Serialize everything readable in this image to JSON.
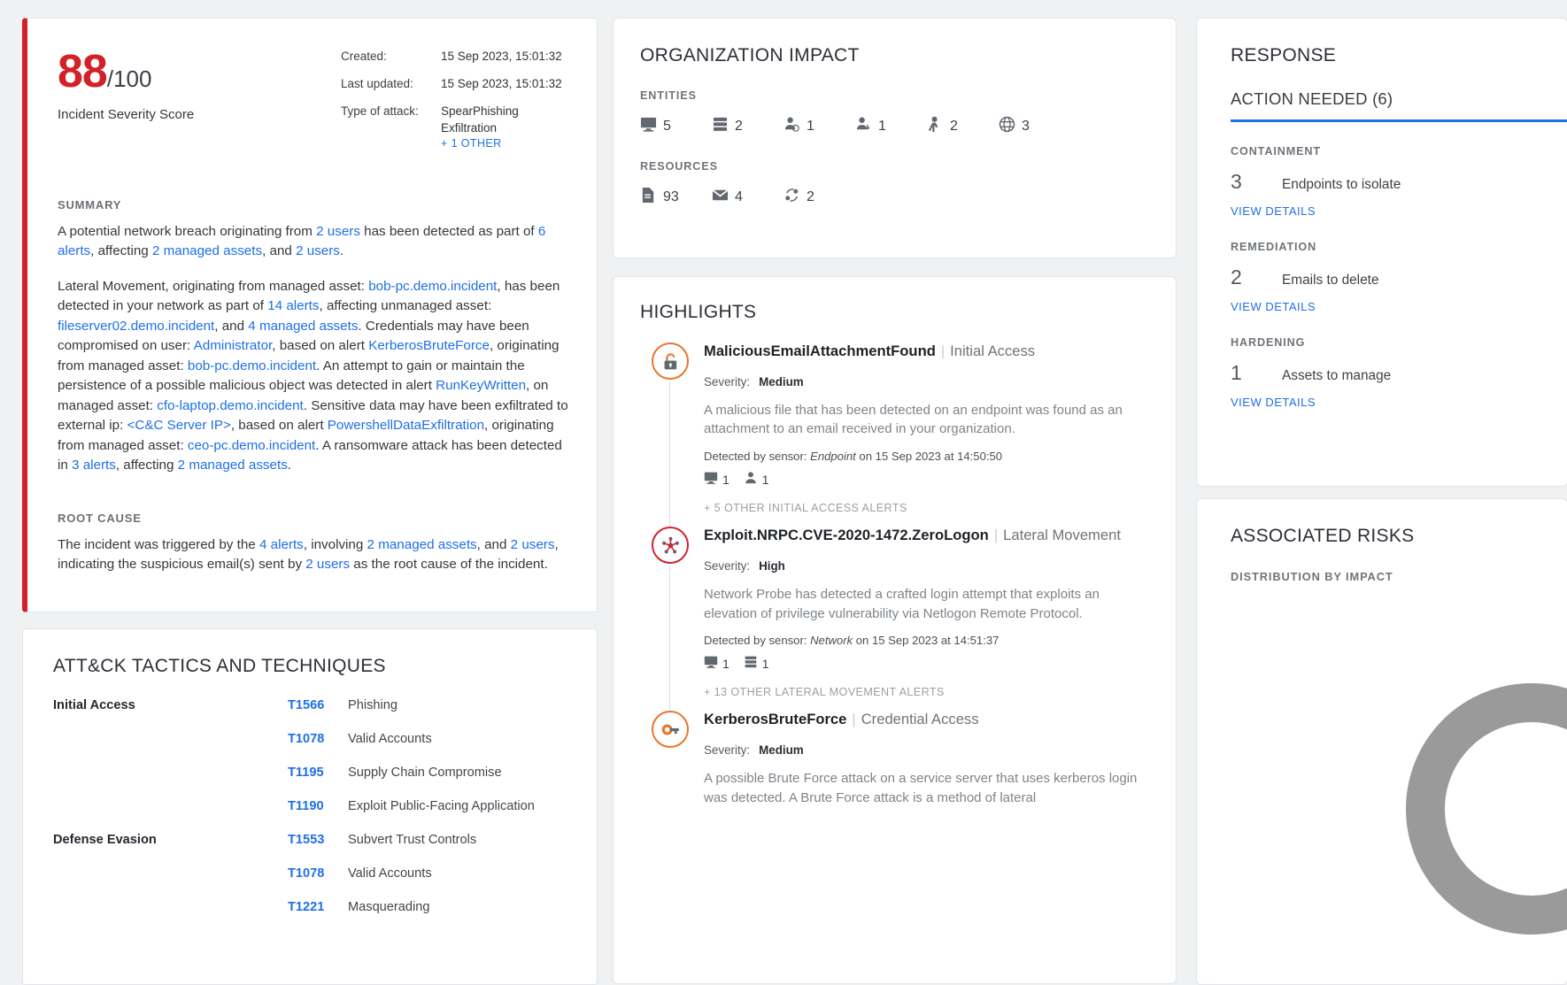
{
  "overview": {
    "score": "88",
    "score_denominator": "/100",
    "score_label": "Incident Severity Score",
    "meta": [
      {
        "key": "Created:",
        "value": "15 Sep 2023, 15:01:32"
      },
      {
        "key": "Last updated:",
        "value": "15 Sep 2023, 15:01:32"
      },
      {
        "key": "Type of attack:",
        "value": "SpearPhishing\nExfiltration"
      }
    ],
    "more_link": "+ 1 OTHER",
    "summary_head": "SUMMARY",
    "summary_p1": [
      {
        "t": "A potential network breach originating from ",
        "link": false
      },
      {
        "t": "2 users",
        "link": true
      },
      {
        "t": " has been detected as part of ",
        "link": false
      },
      {
        "t": "6 alerts",
        "link": true
      },
      {
        "t": ", affecting ",
        "link": false
      },
      {
        "t": "2 managed assets",
        "link": true
      },
      {
        "t": ", and ",
        "link": false
      },
      {
        "t": "2 users",
        "link": true
      },
      {
        "t": ".",
        "link": false
      }
    ],
    "summary_p2": [
      {
        "t": "Lateral Movement, originating from managed asset: ",
        "link": false
      },
      {
        "t": "bob-pc.demo.incident",
        "link": true
      },
      {
        "t": ", has been detected in your network as part of ",
        "link": false
      },
      {
        "t": "14 alerts",
        "link": true
      },
      {
        "t": ", affecting unmanaged asset: ",
        "link": false
      },
      {
        "t": "fileserver02.demo.incident",
        "link": true
      },
      {
        "t": ", and ",
        "link": false
      },
      {
        "t": "4 managed assets",
        "link": true
      },
      {
        "t": ". Credentials may have been compromised on user: ",
        "link": false
      },
      {
        "t": "Administrator",
        "link": true
      },
      {
        "t": ", based on alert ",
        "link": false
      },
      {
        "t": "KerberosBruteForce",
        "link": true
      },
      {
        "t": ", originating from managed asset: ",
        "link": false
      },
      {
        "t": "bob-pc.demo.incident",
        "link": true
      },
      {
        "t": ". An attempt to gain or maintain the persistence of a possible malicious object was detected in alert ",
        "link": false
      },
      {
        "t": "RunKeyWritten",
        "link": true
      },
      {
        "t": ", on managed asset: ",
        "link": false
      },
      {
        "t": "cfo-laptop.demo.incident",
        "link": true
      },
      {
        "t": ". Sensitive data may have been exfiltrated to external ip: ",
        "link": false
      },
      {
        "t": "<C&C Server IP>",
        "link": true
      },
      {
        "t": ", based on alert ",
        "link": false
      },
      {
        "t": "PowershellDataExfiltration",
        "link": true
      },
      {
        "t": ", originating from managed asset: ",
        "link": false
      },
      {
        "t": "ceo-pc.demo.incident",
        "link": true
      },
      {
        "t": ". A ransomware attack has been detected in ",
        "link": false
      },
      {
        "t": "3 alerts",
        "link": true
      },
      {
        "t": ", affecting ",
        "link": false
      },
      {
        "t": "2 managed assets",
        "link": true
      },
      {
        "t": ".",
        "link": false
      }
    ],
    "root_cause_head": "ROOT CAUSE",
    "root_cause_p": [
      {
        "t": "The incident was triggered by the ",
        "link": false
      },
      {
        "t": "4 alerts",
        "link": true
      },
      {
        "t": ", involving ",
        "link": false
      },
      {
        "t": "2 managed assets",
        "link": true
      },
      {
        "t": ", and ",
        "link": false
      },
      {
        "t": "2 users",
        "link": true
      },
      {
        "t": ", indicating the suspicious email(s) sent by ",
        "link": false
      },
      {
        "t": "2 users",
        "link": true
      },
      {
        "t": " as the root cause of the incident.",
        "link": false
      }
    ]
  },
  "attack": {
    "title": "ATT&CK TACTICS AND TECHNIQUES",
    "rows": [
      {
        "tactic": "Initial Access",
        "id": "T1566",
        "name": "Phishing"
      },
      {
        "tactic": "",
        "id": "T1078",
        "name": "Valid Accounts"
      },
      {
        "tactic": "",
        "id": "T1195",
        "name": "Supply Chain Compromise"
      },
      {
        "tactic": "",
        "id": "T1190",
        "name": "Exploit Public-Facing Application"
      },
      {
        "tactic": "Defense Evasion",
        "id": "T1553",
        "name": "Subvert Trust Controls"
      },
      {
        "tactic": "",
        "id": "T1078",
        "name": "Valid Accounts"
      },
      {
        "tactic": "",
        "id": "T1221",
        "name": "Masquerading"
      }
    ]
  },
  "organization": {
    "title": "ORGANIZATION IMPACT",
    "entities_head": "ENTITIES",
    "entities": [
      {
        "icon": "endpoint-icon",
        "count": "5"
      },
      {
        "icon": "server-icon",
        "count": "2"
      },
      {
        "icon": "user-clock-icon",
        "count": "1"
      },
      {
        "icon": "user-download-icon",
        "count": "1"
      },
      {
        "icon": "user-activity-icon",
        "count": "2"
      },
      {
        "icon": "globe-icon",
        "count": "3"
      }
    ],
    "resources_head": "RESOURCES",
    "resources": [
      {
        "icon": "file-icon",
        "count": "93"
      },
      {
        "icon": "envelope-icon",
        "count": "4"
      },
      {
        "icon": "process-icon",
        "count": "2"
      }
    ]
  },
  "highlights": {
    "title": "HIGHLIGHTS",
    "items": [
      {
        "icon": "unlock-icon",
        "accent": "#e8762c",
        "name": "MaliciousEmailAttachmentFound",
        "tactic": "Initial Access",
        "severity_label": "Severity:",
        "severity": "Medium",
        "description": "A malicious file that has been detected on an endpoint was found as an attachment to an email received in your organization.",
        "sensor_prefix": "Detected by sensor:",
        "sensor": "Endpoint",
        "sensor_suffix": "on 15 Sep 2023 at 14:50:50",
        "counts": [
          {
            "icon": "endpoint-icon",
            "count": "1"
          },
          {
            "icon": "user-icon",
            "count": "1"
          }
        ],
        "more": "+ 5 OTHER INITIAL ACCESS ALERTS"
      },
      {
        "icon": "network-node-icon",
        "accent": "#cf2233",
        "name": "Exploit.NRPC.CVE-2020-1472.ZeroLogon",
        "tactic": "Lateral Movement",
        "severity_label": "Severity:",
        "severity": "High",
        "description": "Network Probe has detected a crafted login attempt that exploits an elevation of privilege vulnerability via Netlogon Remote Protocol.",
        "sensor_prefix": "Detected by sensor:",
        "sensor": "Network",
        "sensor_suffix": "on 15 Sep 2023 at 14:51:37",
        "counts": [
          {
            "icon": "endpoint-icon",
            "count": "1"
          },
          {
            "icon": "server-icon",
            "count": "1"
          }
        ],
        "more": "+ 13 OTHER LATERAL MOVEMENT ALERTS"
      },
      {
        "icon": "key-icon",
        "accent": "#e8762c",
        "name": "KerberosBruteForce",
        "tactic": "Credential Access",
        "severity_label": "Severity:",
        "severity": "Medium",
        "description": "A possible Brute Force attack on a service server that uses kerberos login was detected. A Brute Force attack is a method of lateral",
        "sensor_prefix": "",
        "sensor": "",
        "sensor_suffix": "",
        "counts": [],
        "more": ""
      }
    ]
  },
  "response": {
    "title": "RESPONSE",
    "tab_label": "ACTION NEEDED (6)",
    "groups": [
      {
        "head": "CONTAINMENT",
        "count": "3",
        "text": "Endpoints to isolate",
        "link": "VIEW DETAILS"
      },
      {
        "head": "REMEDIATION",
        "count": "2",
        "text": "Emails to delete",
        "link": "VIEW DETAILS"
      },
      {
        "head": "HARDENING",
        "count": "1",
        "text": "Assets to manage",
        "link": "VIEW DETAILS"
      }
    ]
  },
  "risk": {
    "title": "ASSOCIATED RISKS",
    "subtitle": "DISTRIBUTION BY IMPACT"
  }
}
